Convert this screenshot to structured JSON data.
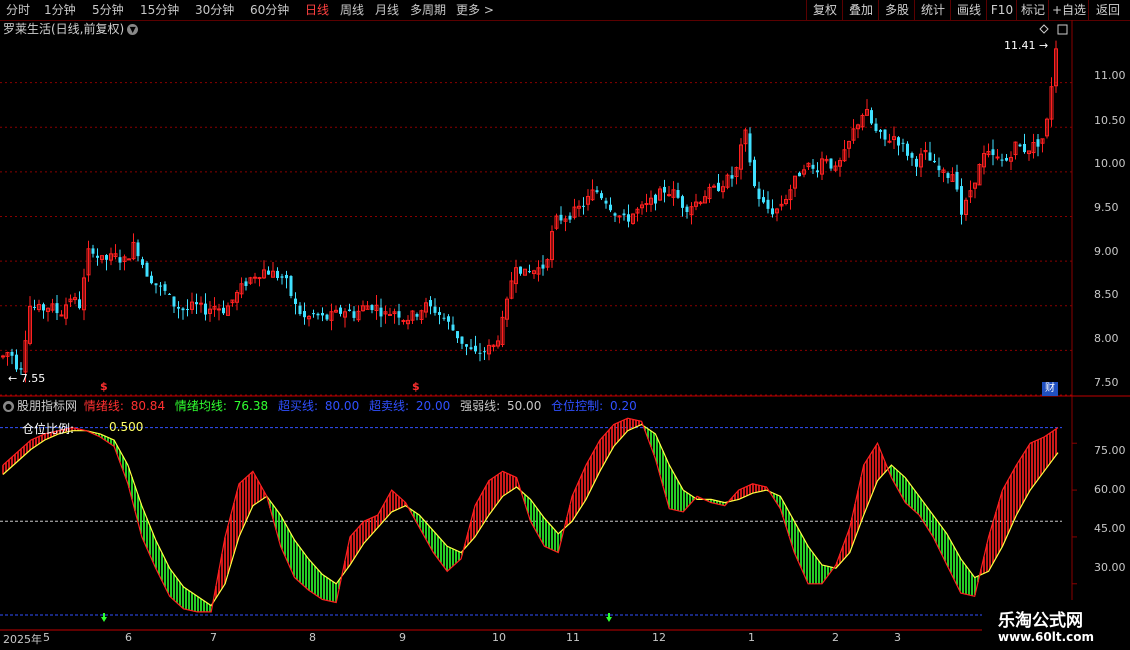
{
  "toolbar": {
    "periods": [
      "分时",
      "1分钟",
      "5分钟",
      "15分钟",
      "30分钟",
      "60分钟",
      "日线",
      "周线",
      "月线",
      "多周期",
      "更多 >"
    ],
    "active_period": "日线",
    "buttons": [
      "复权",
      "叠加",
      "多股",
      "统计",
      "画线",
      "F10",
      "标记",
      "+自选",
      "返回"
    ]
  },
  "main_chart": {
    "title": "罗莱生活(日线,前复权)",
    "high_label": "11.41",
    "low_label": "7.55",
    "y_ticks": [
      "11.00",
      "10.50",
      "10.00",
      "9.50",
      "9.00",
      "8.50",
      "8.00",
      "7.50"
    ],
    "finance_badge": "财",
    "event_markers": [
      "$",
      "$"
    ]
  },
  "indicator": {
    "name": "股朋指标网",
    "items": [
      {
        "label": "情绪线:",
        "value": "80.84",
        "color": "#ff3030"
      },
      {
        "label": "情绪均线:",
        "value": "76.38",
        "color": "#30ff30"
      },
      {
        "label": "超买线:",
        "value": "80.00",
        "color": "#3050ff"
      },
      {
        "label": "超卖线:",
        "value": "20.00",
        "color": "#3050ff"
      },
      {
        "label": "强弱线:",
        "value": "50.00",
        "color": "#c8c8c8"
      },
      {
        "label": "仓位控制:",
        "value": "0.20",
        "color": "#3050ff"
      }
    ],
    "position_label": "仓位比例:",
    "position_value": "0.500",
    "y_ticks": [
      "75.00",
      "60.00",
      "45.00",
      "30.00"
    ]
  },
  "x_axis": [
    "2025年",
    "5",
    "6",
    "7",
    "8",
    "9",
    "10",
    "11",
    "12",
    "1",
    "2",
    "3"
  ],
  "watermark": {
    "line1": "乐淘公式网",
    "line2": "www.60lt.com"
  },
  "colors": {
    "up": "#ff2020",
    "down": "#40e0ff",
    "emotion": "#ff2020",
    "avg": "#30ff30",
    "grid": "#8a0000"
  },
  "chart_data": [
    {
      "type": "candlestick",
      "title": "罗莱生活(日线,前复权)",
      "ylim": [
        7.5,
        11.5
      ],
      "x_start": "2025年",
      "points": [
        [
          0,
          7.9
        ],
        [
          10,
          8.0
        ],
        [
          20,
          7.75
        ],
        [
          30,
          8.5
        ],
        [
          40,
          8.45
        ],
        [
          50,
          8.5
        ],
        [
          60,
          8.4
        ],
        [
          70,
          8.6
        ],
        [
          80,
          8.5
        ],
        [
          90,
          9.2
        ],
        [
          100,
          9.0
        ],
        [
          115,
          9.05
        ],
        [
          125,
          9.0
        ],
        [
          135,
          9.2
        ],
        [
          145,
          8.9
        ],
        [
          155,
          8.75
        ],
        [
          165,
          8.65
        ],
        [
          175,
          8.5
        ],
        [
          185,
          8.45
        ],
        [
          195,
          8.5
        ],
        [
          205,
          8.45
        ],
        [
          215,
          8.5
        ],
        [
          225,
          8.45
        ],
        [
          235,
          8.6
        ],
        [
          245,
          8.75
        ],
        [
          255,
          8.85
        ],
        [
          265,
          8.9
        ],
        [
          275,
          8.85
        ],
        [
          285,
          8.8
        ],
        [
          295,
          8.5
        ],
        [
          305,
          8.35
        ],
        [
          315,
          8.4
        ],
        [
          325,
          8.35
        ],
        [
          335,
          8.4
        ],
        [
          345,
          8.45
        ],
        [
          355,
          8.4
        ],
        [
          365,
          8.5
        ],
        [
          375,
          8.5
        ],
        [
          385,
          8.4
        ],
        [
          395,
          8.45
        ],
        [
          405,
          8.35
        ],
        [
          415,
          8.4
        ],
        [
          425,
          8.5
        ],
        [
          435,
          8.45
        ],
        [
          445,
          8.35
        ],
        [
          455,
          8.2
        ],
        [
          465,
          8.05
        ],
        [
          475,
          7.95
        ],
        [
          485,
          8.0
        ],
        [
          495,
          8.05
        ],
        [
          505,
          8.4
        ],
        [
          515,
          9.0
        ],
        [
          525,
          8.85
        ],
        [
          535,
          8.9
        ],
        [
          545,
          8.95
        ],
        [
          555,
          9.45
        ],
        [
          565,
          9.5
        ],
        [
          575,
          9.55
        ],
        [
          585,
          9.65
        ],
        [
          595,
          9.8
        ],
        [
          605,
          9.7
        ],
        [
          615,
          9.55
        ],
        [
          625,
          9.45
        ],
        [
          635,
          9.55
        ],
        [
          645,
          9.6
        ],
        [
          655,
          9.7
        ],
        [
          665,
          9.8
        ],
        [
          675,
          9.75
        ],
        [
          685,
          9.6
        ],
        [
          695,
          9.65
        ],
        [
          705,
          9.75
        ],
        [
          715,
          9.8
        ],
        [
          725,
          9.9
        ],
        [
          735,
          9.95
        ],
        [
          745,
          10.45
        ],
        [
          755,
          9.8
        ],
        [
          765,
          9.6
        ],
        [
          775,
          9.55
        ],
        [
          785,
          9.7
        ],
        [
          795,
          9.9
        ],
        [
          805,
          10.1
        ],
        [
          815,
          10.0
        ],
        [
          825,
          10.2
        ],
        [
          835,
          10.0
        ],
        [
          845,
          10.2
        ],
        [
          855,
          10.5
        ],
        [
          865,
          10.7
        ],
        [
          875,
          10.45
        ],
        [
          885,
          10.35
        ],
        [
          895,
          10.4
        ],
        [
          905,
          10.25
        ],
        [
          915,
          10.1
        ],
        [
          925,
          10.2
        ],
        [
          935,
          10.05
        ],
        [
          945,
          9.95
        ],
        [
          955,
          10.0
        ],
        [
          962,
          9.5
        ],
        [
          972,
          9.85
        ],
        [
          985,
          10.2
        ],
        [
          995,
          10.15
        ],
        [
          1005,
          10.1
        ],
        [
          1015,
          10.3
        ],
        [
          1025,
          10.25
        ],
        [
          1035,
          10.3
        ],
        [
          1045,
          10.4
        ],
        [
          1050,
          10.8
        ],
        [
          1055,
          11.41
        ]
      ]
    },
    {
      "type": "line",
      "title": "股朋指标网",
      "ylim": [
        20,
        85
      ],
      "series": [
        {
          "name": "情绪线",
          "values": [
            68,
            72,
            76,
            78,
            79,
            80,
            79,
            77,
            74,
            62,
            45,
            35,
            26,
            22,
            21,
            21,
            45,
            62,
            66,
            58,
            42,
            32,
            28,
            25,
            24,
            45,
            50,
            52,
            60,
            56,
            48,
            40,
            34,
            38,
            55,
            63,
            66,
            64,
            50,
            42,
            40,
            58,
            68,
            76,
            81,
            83,
            82,
            70,
            54,
            53,
            58,
            56,
            55,
            60,
            62,
            61,
            54,
            40,
            30,
            30,
            36,
            48,
            68,
            75,
            64,
            56,
            52,
            45,
            36,
            27,
            26,
            45,
            60,
            68,
            75,
            77,
            80
          ]
        },
        {
          "name": "情绪均线",
          "values": [
            65,
            69,
            73,
            76,
            78,
            79,
            79,
            78,
            76,
            68,
            55,
            44,
            35,
            29,
            26,
            23,
            30,
            45,
            55,
            58,
            52,
            44,
            38,
            33,
            30,
            36,
            43,
            48,
            53,
            55,
            52,
            47,
            42,
            40,
            45,
            52,
            58,
            61,
            57,
            51,
            46,
            50,
            57,
            66,
            74,
            79,
            81,
            78,
            68,
            60,
            57,
            57,
            56,
            57,
            59,
            60,
            58,
            50,
            42,
            36,
            35,
            40,
            52,
            63,
            68,
            64,
            58,
            52,
            46,
            38,
            32,
            34,
            42,
            52,
            60,
            66,
            72
          ]
        },
        {
          "name": "超买线",
          "values": [
            80
          ]
        },
        {
          "name": "超卖线",
          "values": [
            20
          ]
        },
        {
          "name": "强弱线",
          "values": [
            50
          ]
        }
      ]
    }
  ]
}
